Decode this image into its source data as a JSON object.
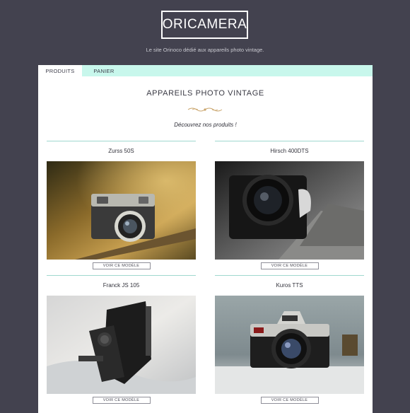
{
  "site": {
    "logo": "ORICAMERA",
    "tagline": "Le site Orinoco dédié aux appareils photo vintage."
  },
  "tabs": [
    {
      "label": "PRODUITS",
      "active": true
    },
    {
      "label": "PANIER",
      "active": false
    }
  ],
  "main": {
    "title": "APPAREILS PHOTO VINTAGE",
    "intro": "Découvrez nos produits !",
    "view_button_label": "VOIR CE MODÈLE"
  },
  "products": [
    {
      "name": "Zurss 50S"
    },
    {
      "name": "Hirsch 400DTS"
    },
    {
      "name": "Franck JS 105"
    },
    {
      "name": "Kuros TTS"
    }
  ],
  "colors": {
    "background": "#43424f",
    "tab_bar": "#c8f7ec",
    "divider": "#9fd8cf",
    "ornament": "#c9a46a"
  }
}
